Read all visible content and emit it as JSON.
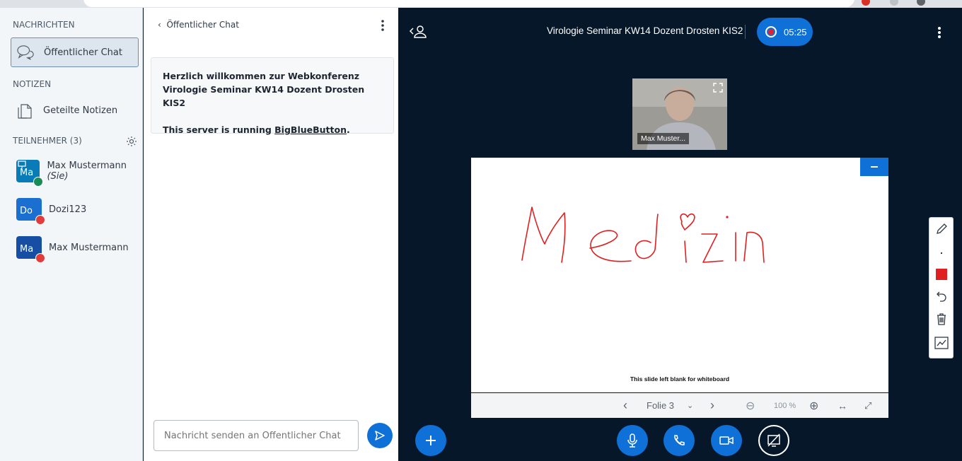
{
  "messages_section": {
    "title": "NACHRICHTEN",
    "public_chat": "Öffentlicher Chat"
  },
  "notes_section": {
    "title": "NOTIZEN",
    "shared_notes": "Geteilte Notizen"
  },
  "participants": {
    "title": "TEILNEHMER (3)",
    "users": [
      {
        "initials": "Ma",
        "name": "Max Mustermann",
        "suffix": "(Sie)",
        "color": "#097cb7",
        "presenter": true,
        "status": "mic-on"
      },
      {
        "initials": "Do",
        "name": "Dozi123",
        "suffix": "",
        "color": "#1b6fd1",
        "presenter": false,
        "status": "muted"
      },
      {
        "initials": "Ma",
        "name": "Max Mustermann",
        "suffix": "",
        "color": "#164ea3",
        "presenter": false,
        "status": "muted"
      }
    ]
  },
  "chat": {
    "header": "Öffentlicher Chat",
    "welcome_line": "Herzlich willkommen zur Webkonferenz Virologie Seminar KW14 Dozent Drosten KIS2",
    "server_prefix": "This server is running ",
    "server_link": "BigBlueButton",
    "server_suffix": ".",
    "input_placeholder": "Nachricht senden an Öffentlicher Chat"
  },
  "meeting": {
    "title": "Virologie Seminar KW14 Dozent Drosten KIS2",
    "recording_time": "05:25"
  },
  "webcam": {
    "name": "Max Muster..."
  },
  "slide": {
    "handwriting": "Medizin",
    "caption": "This slide left blank for whiteboard"
  },
  "presentation_toolbar": {
    "slide_label": "Folie 3",
    "zoom": "100 %"
  },
  "colors": {
    "accent": "#0f70d7",
    "ink": "#e02020",
    "background": "#06172a"
  }
}
